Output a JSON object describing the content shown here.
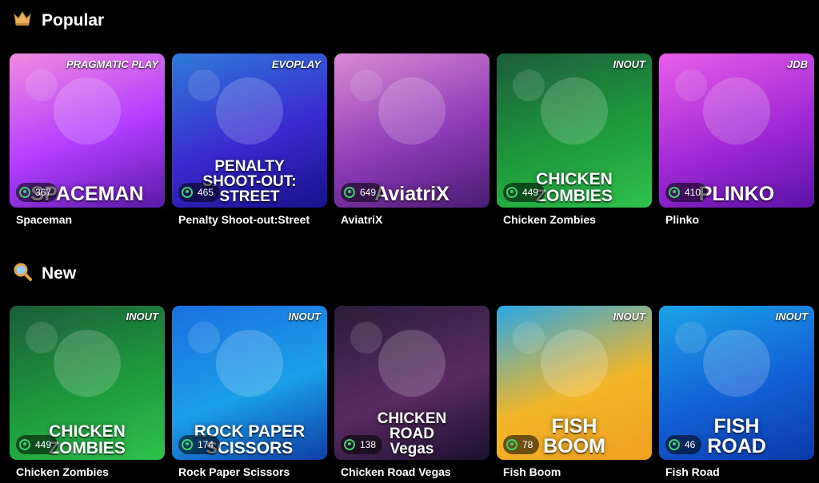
{
  "sections": [
    {
      "title": "Popular",
      "icon": "crown-icon",
      "games": [
        {
          "name": "Spaceman",
          "players": "367",
          "art_title": "SPACEMAN",
          "brand": "PRAGMATIC PLAY",
          "colors": [
            "#f08be0",
            "#b13cff",
            "#5a1ba8"
          ]
        },
        {
          "name": "Penalty Shoot-out:Street",
          "players": "465",
          "art_title": "PENALTY\nSHOOT-OUT:\nSTREET",
          "brand": "EVOPLAY",
          "colors": [
            "#2e7bd8",
            "#3a2ad0",
            "#16128a"
          ]
        },
        {
          "name": "AviatriX",
          "players": "649",
          "art_title": "AviatriX",
          "brand": "",
          "colors": [
            "#d98ad4",
            "#8f3bb7",
            "#4a1c74"
          ]
        },
        {
          "name": "Chicken Zombies",
          "players": "449",
          "art_title": "CHICKEN\nZOMBIES",
          "brand": "INOUT",
          "colors": [
            "#1c5c3a",
            "#1e9a3c",
            "#2ec24c"
          ]
        },
        {
          "name": "Plinko",
          "players": "410",
          "art_title": "PLINKO",
          "brand": "JDB",
          "colors": [
            "#e85ee8",
            "#a12ad6",
            "#5b12a8"
          ]
        }
      ]
    },
    {
      "title": "New",
      "icon": "magnifier-icon",
      "games": [
        {
          "name": "Chicken Zombies",
          "players": "449",
          "art_title": "CHICKEN\nZOMBIES",
          "brand": "INOUT",
          "colors": [
            "#1c5c3a",
            "#1e9a3c",
            "#2ec24c"
          ]
        },
        {
          "name": "Rock Paper Scissors",
          "players": "174",
          "art_title": "ROCK PAPER\nSCISSORS",
          "brand": "INOUT",
          "colors": [
            "#1a6fe0",
            "#1aa0e8",
            "#0e3fa8"
          ]
        },
        {
          "name": "Chicken Road Vegas",
          "players": "138",
          "art_title": "CHICKEN\nROAD\nVegas",
          "brand": "",
          "colors": [
            "#2a1c3a",
            "#5a2b62",
            "#1b1030"
          ]
        },
        {
          "name": "Fish Boom",
          "players": "78",
          "art_title": "FISH\nBOOM",
          "brand": "INOUT",
          "colors": [
            "#29a7e6",
            "#f2b62a",
            "#f0a020"
          ]
        },
        {
          "name": "Fish Road",
          "players": "46",
          "art_title": "FISH\nROAD",
          "brand": "INOUT",
          "colors": [
            "#1aa3e6",
            "#1360d6",
            "#0b3aa8"
          ]
        }
      ]
    }
  ]
}
